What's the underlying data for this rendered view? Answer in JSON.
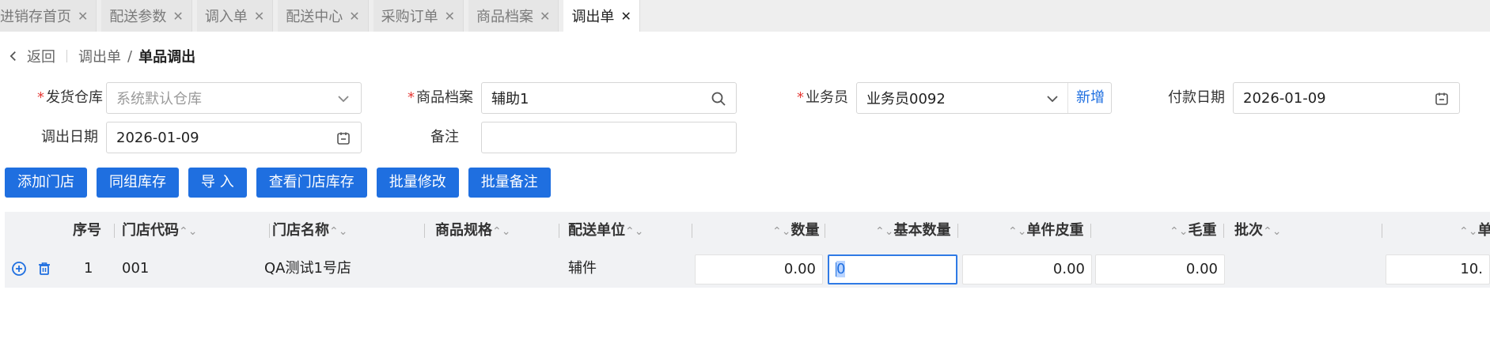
{
  "tabs": [
    {
      "label": "进销存首页",
      "close": "✕"
    },
    {
      "label": "配送参数",
      "close": "✕"
    },
    {
      "label": "调入单",
      "close": "✕"
    },
    {
      "label": "配送中心",
      "close": "✕"
    },
    {
      "label": "采购订单",
      "close": "✕"
    },
    {
      "label": "商品档案",
      "close": "✕"
    },
    {
      "label": "调出单",
      "close": "✕",
      "active": true
    }
  ],
  "breadcrumb": {
    "back_label": "返回",
    "parent": "调出单",
    "separator": "/",
    "current": "单品调出"
  },
  "form": {
    "required_mark": "*",
    "warehouse": {
      "label": "发货仓库",
      "placeholder": "系统默认仓库"
    },
    "product": {
      "label": "商品档案",
      "value": "辅助1"
    },
    "salesman": {
      "label": "业务员",
      "value": "业务员0092",
      "add_label": "新增"
    },
    "pay_date": {
      "label": "付款日期",
      "value": "2026-01-09"
    },
    "out_date": {
      "label": "调出日期",
      "value": "2026-01-09"
    },
    "remark": {
      "label": "备注",
      "value": ""
    }
  },
  "toolbar": {
    "add_store": "添加门店",
    "same_group_stock": "同组库存",
    "import": "导 入",
    "view_store_stock": "查看门店库存",
    "batch_edit": "批量修改",
    "batch_remark": "批量备注"
  },
  "table": {
    "sort_glyph": "⌃⌄",
    "columns": {
      "seq": "序号",
      "store_code": "门店代码",
      "store_name": "门店名称",
      "spec": "商品规格",
      "unit": "配送单位",
      "qty": "数量",
      "base_qty": "基本数量",
      "tare": "单件皮重",
      "gross": "毛重",
      "batch": "批次",
      "price": "单"
    },
    "rows": [
      {
        "seq": "1",
        "store_code": "001",
        "store_name": "QA测试1号店",
        "spec": "",
        "unit": "辅件",
        "qty": "0.00",
        "base_qty": "0",
        "tare": "0.00",
        "gross": "0.00",
        "batch": "",
        "price": "10."
      }
    ]
  },
  "colors": {
    "primary": "#1f6fe0",
    "required": "#e53935",
    "table_header_bg": "#f1f2f4",
    "focus_border": "#2f7ae5"
  }
}
